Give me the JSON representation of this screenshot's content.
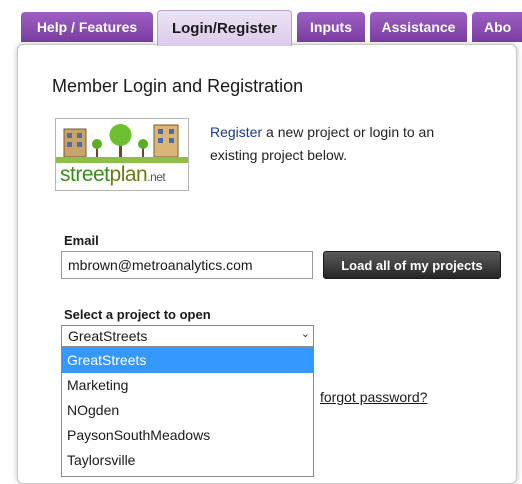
{
  "tabs": [
    {
      "label": "Help / Features",
      "active": false
    },
    {
      "label": "Login/Register",
      "active": true
    },
    {
      "label": "Inputs",
      "active": false
    },
    {
      "label": "Assistance",
      "active": false
    },
    {
      "label": "Abo",
      "active": false
    }
  ],
  "page_title": "Member Login and Registration",
  "logo": {
    "part1": "street",
    "part2": "plan",
    "suffix": ".net"
  },
  "intro": {
    "link": "Register",
    "text": " a new project or login to an existing project below."
  },
  "email": {
    "label": "Email",
    "value": "mbrown@metroanalytics.com"
  },
  "load_button": "Load all of my projects",
  "project_select": {
    "label": "Select a project to open",
    "selected": "GreatStreets",
    "options": [
      "GreatStreets",
      "Marketing",
      "NOgden",
      "PaysonSouthMeadows",
      "Taylorsville"
    ]
  },
  "forgot_link": "forgot password?",
  "colors": {
    "tab_purple": "#8a4db5",
    "tab_active": "#e3d6ef",
    "option_highlight": "#3399ff",
    "button_dark": "#333333",
    "link_blue": "#1a3a8f",
    "logo_green": "#3d8a1f"
  }
}
